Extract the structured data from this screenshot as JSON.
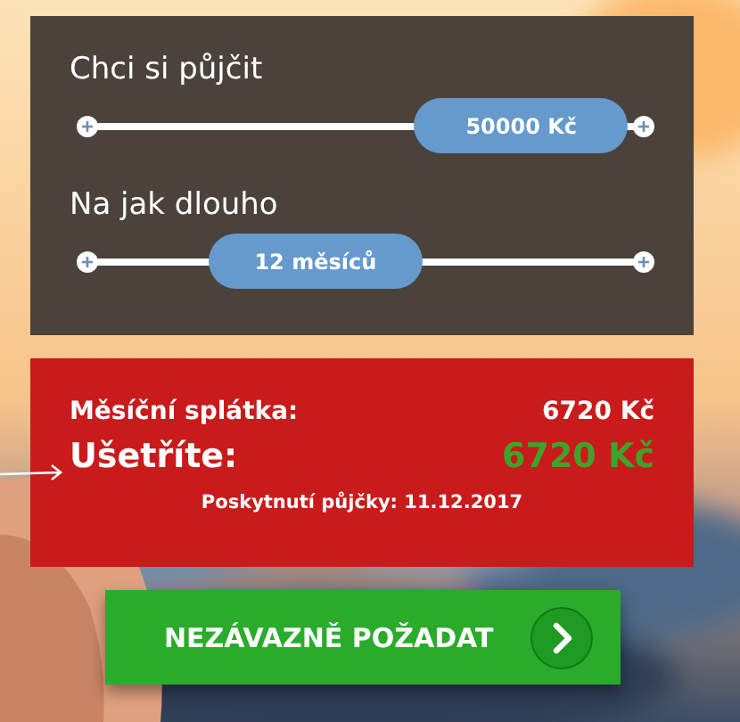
{
  "sliders": [
    {
      "label": "Chci si půjčit",
      "value": "50000 Kč",
      "level": 0.78
    },
    {
      "label": "Na jak dlouho",
      "value": "12 měsíců",
      "level": 0.41
    }
  ],
  "summary": {
    "rows": [
      {
        "label": "Měsíční splátka:",
        "value": "6720 Kč",
        "kind": "plain"
      },
      {
        "label": "Ušetříte:",
        "value": "6720 Kč",
        "kind": "highlight"
      }
    ],
    "note": "Poskytnutí půjčky: 11.12.2017"
  },
  "button": {
    "label": "NEZÁVAZNĚ POŽADAT"
  }
}
